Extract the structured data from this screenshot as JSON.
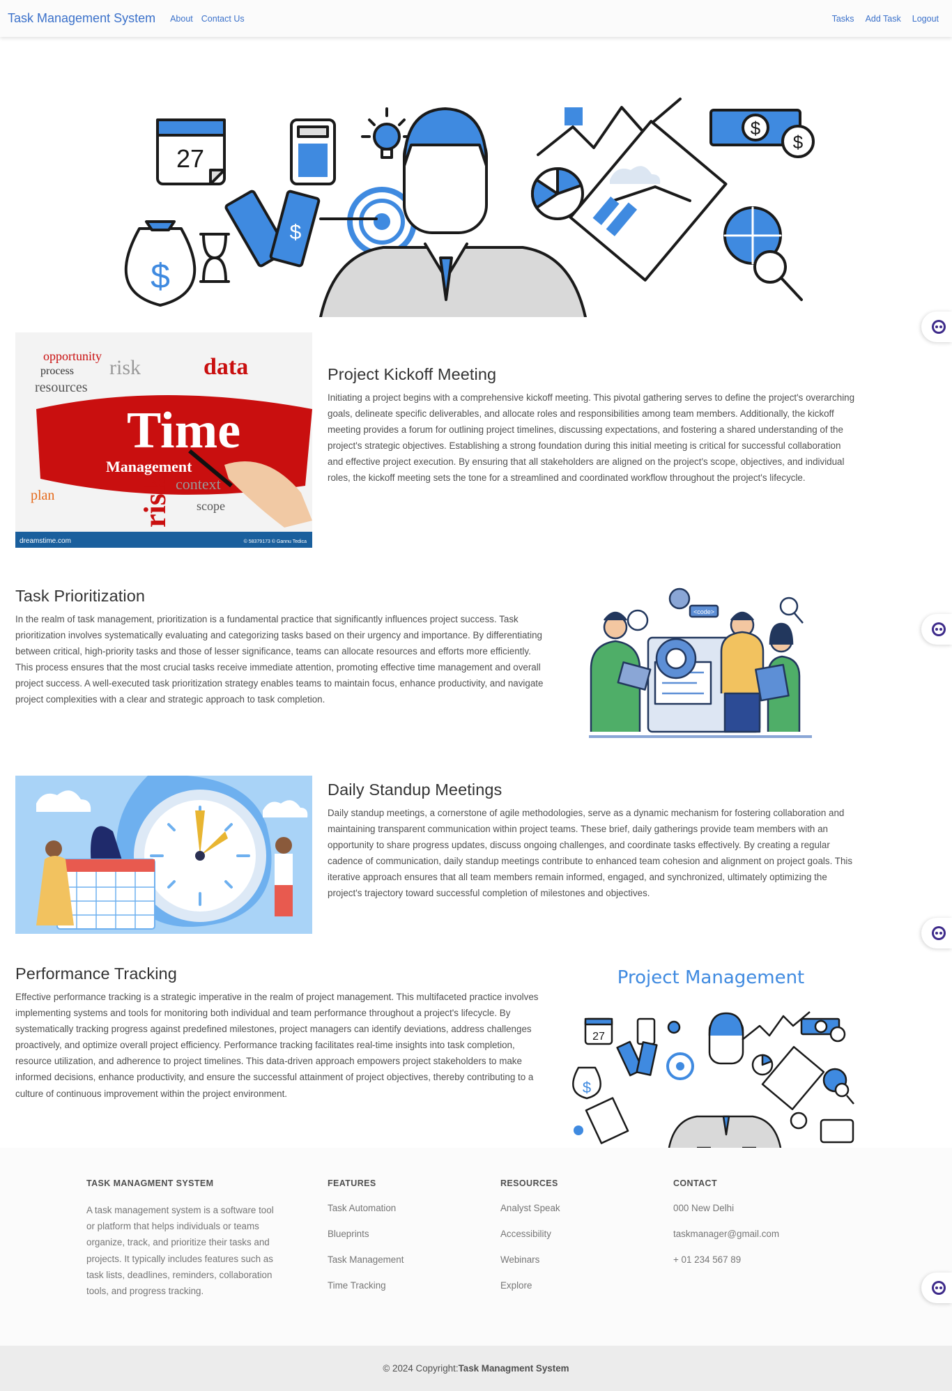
{
  "navbar": {
    "brand": "Task Management System",
    "left_links": [
      "About",
      "Contact Us"
    ],
    "right_links": [
      "Tasks",
      "Add Task",
      "Logout"
    ]
  },
  "sections": {
    "kickoff": {
      "title": "Project Kickoff Meeting",
      "text": "Initiating a project begins with a comprehensive kickoff meeting. This pivotal gathering serves to define the project's overarching goals, delineate specific deliverables, and allocate roles and responsibilities among team members. Additionally, the kickoff meeting provides a forum for outlining project timelines, discussing expectations, and fostering a shared understanding of the project's strategic objectives. Establishing a strong foundation during this initial meeting is critical for successful collaboration and effective project execution. By ensuring that all stakeholders are aligned on the project's scope, objectives, and individual roles, the kickoff meeting sets the tone for a streamlined and coordinated workflow throughout the project's lifecycle.",
      "image": {
        "words": [
          "Time",
          "Management",
          "risk",
          "data",
          "plan",
          "opportunity",
          "process",
          "resources",
          "scope",
          "context"
        ],
        "watermark_left": "dreamstime.com",
        "watermark_right": "© 58379173 © Gannu Tedica"
      }
    },
    "prioritization": {
      "title": "Task Prioritization",
      "text": "In the realm of task management, prioritization is a fundamental practice that significantly influences project success. Task prioritization involves systematically evaluating and categorizing tasks based on their urgency and importance. By differentiating between critical, high-priority tasks and those of lesser significance, teams can allocate resources and efforts more efficiently. This process ensures that the most crucial tasks receive immediate attention, promoting effective time management and overall project success. A well-executed task prioritization strategy enables teams to maintain focus, enhance productivity, and navigate project complexities with a clear and strategic approach to task completion.",
      "image": {
        "code_tag": "<code>"
      }
    },
    "standup": {
      "title": "Daily Standup Meetings",
      "text": "Daily standup meetings, a cornerstone of agile methodologies, serve as a dynamic mechanism for fostering collaboration and maintaining transparent communication within project teams. These brief, daily gatherings provide team members with an opportunity to share progress updates, discuss ongoing challenges, and coordinate tasks effectively. By creating a regular cadence of communication, daily standup meetings contribute to enhanced team cohesion and alignment on project goals. This iterative approach ensures that all team members remain informed, engaged, and synchronized, ultimately optimizing the project's trajectory toward successful completion of milestones and objectives."
    },
    "tracking": {
      "title": "Performance Tracking",
      "text": "Effective performance tracking is a strategic imperative in the realm of project management. This multifaceted practice involves implementing systems and tools for monitoring both individual and team performance throughout a project's lifecycle. By systematically tracking progress against predefined milestones, project managers can identify deviations, address challenges proactively, and optimize overall project efficiency. Performance tracking facilitates real-time insights into task completion, resource utilization, and adherence to project timelines. This data-driven approach empowers project stakeholders to make informed decisions, enhance productivity, and ensure the successful attainment of project objectives, thereby contributing to a culture of continuous improvement within the project environment.",
      "image": {
        "heading": "Project Management"
      }
    }
  },
  "hero": {
    "calendar_day": "27"
  },
  "footer": {
    "about": {
      "heading": "TASK MANAGMENT SYSTEM",
      "text": "A task management system is a software tool or platform that helps individuals or teams organize, track, and prioritize their tasks and projects. It typically includes features such as task lists, deadlines, reminders, collaboration tools, and progress tracking."
    },
    "features": {
      "heading": "FEATURES",
      "links": [
        "Task Automation",
        "Blueprints",
        "Task Management",
        "Time Tracking"
      ]
    },
    "resources": {
      "heading": "RESOURCES",
      "links": [
        "Analyst Speak",
        "Accessibility",
        "Webinars",
        "Explore"
      ]
    },
    "contact": {
      "heading": "CONTACT",
      "items": [
        "000 New Delhi",
        "taskmanager@gmail.com",
        "+ 01 234 567 89"
      ]
    },
    "copyright_prefix": "© 2024 Copyright:",
    "copyright_name": "Task Managment System"
  },
  "colors": {
    "accent": "#3b71ca",
    "illustration_blue": "#3f8ae0",
    "footer_bg": "#fbfbfb",
    "copyright_bg": "#ececec"
  }
}
